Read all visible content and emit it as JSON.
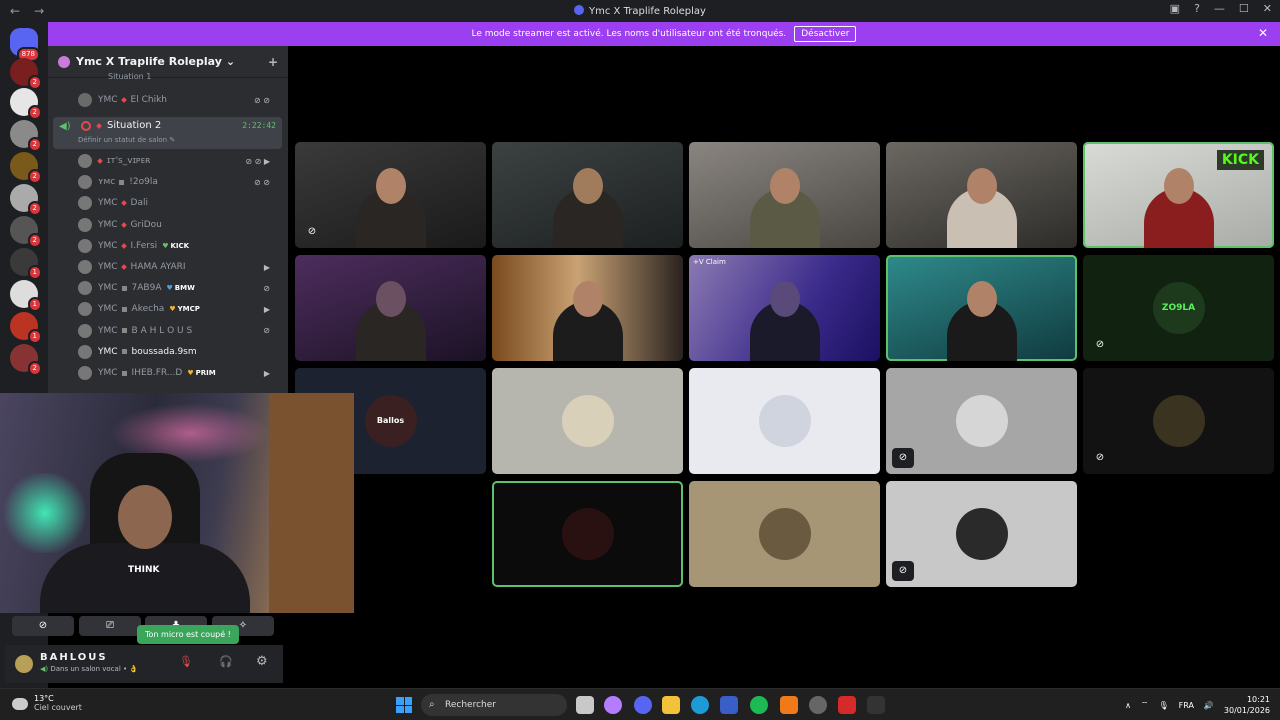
{
  "window": {
    "title": "Ymc X Traplife Roleplay",
    "nav_back": "←",
    "nav_forward": "→",
    "buttons": [
      "▣",
      "?",
      "—",
      "☐",
      "✕"
    ]
  },
  "banner": {
    "text": "Le mode streamer est activé. Les noms d'utilisateur ont été tronqués.",
    "button": "Désactiver",
    "close": "✕"
  },
  "guilds": {
    "home_badge": "878",
    "badges": [
      "2",
      "2",
      "2",
      "2",
      "2",
      "2",
      "1",
      "1",
      "1",
      "2"
    ]
  },
  "server": {
    "name": "Ymc X Traplife Roleplay",
    "chevron": "⌄",
    "add_people": "+"
  },
  "channel_prev": {
    "name": "Situation 1",
    "user": {
      "tag": "YMC",
      "name": "El Chikh"
    }
  },
  "voice_channel": {
    "name": "Situation 2",
    "time": "2:22:42",
    "status": "Définir un statut de salon ✎"
  },
  "members": [
    {
      "tag": "",
      "name": "ɪᴛ'ꜱ_ᴠɪᴘᴇʀ",
      "badge": "",
      "marker": "dot"
    },
    {
      "tag": "ʏᴍᴄ",
      "name": "!2o9la",
      "badge": "",
      "marker": "sq"
    },
    {
      "tag": "YMC",
      "name": "Dali",
      "badge": "",
      "marker": "dot"
    },
    {
      "tag": "YMC",
      "name": "GriDou",
      "badge": "",
      "marker": "dot"
    },
    {
      "tag": "YMC",
      "name": "I.Fersi",
      "badge": "KICK",
      "marker": "dot"
    },
    {
      "tag": "YMC",
      "name": "HAMA AYARI",
      "badge": "",
      "marker": "dot"
    },
    {
      "tag": "YMC",
      "name": "7AB9A",
      "badge": "BMW",
      "marker": "sq"
    },
    {
      "tag": "YMC",
      "name": "Akecha",
      "badge": "YMCP",
      "marker": "sq"
    },
    {
      "tag": "YMC",
      "name": "B A H L O U S",
      "badge": "",
      "marker": "sq"
    },
    {
      "tag": "YMC",
      "name": "boussada.9sm",
      "badge": "",
      "marker": "sq"
    },
    {
      "tag": "YMC",
      "name": "IHEB.FR...D",
      "badge": "PRIM",
      "marker": "sq"
    }
  ],
  "tiles": {
    "label_claim": "+V Claim",
    "kick_text": "KICK",
    "zo9la_text": "ZO9LA",
    "ballos_text": "Ballos"
  },
  "popup_cam": {
    "shirt_text": "THINK"
  },
  "controls": {
    "camera": "⊘",
    "screenshare": "⎚",
    "activity": "♣",
    "soundboard": "✧"
  },
  "toast": "Ton micro est coupé !",
  "user_panel": {
    "name": "BAHLOUS",
    "status": "Dans un salon vocal • 👌",
    "mic": "🎙",
    "headset": "🎧",
    "settings": "⚙"
  },
  "taskbar": {
    "temp": "13°C",
    "weather": "Ciel couvert",
    "search": "Rechercher",
    "lang": "FRA",
    "time": "10:21",
    "date": "30/01/2026",
    "tray_arrow": "∧"
  },
  "colors": {
    "banner": "#9b3ff1",
    "speaking": "#5ec26a",
    "danger": "#e24b4b",
    "toast": "#3ba55c"
  }
}
